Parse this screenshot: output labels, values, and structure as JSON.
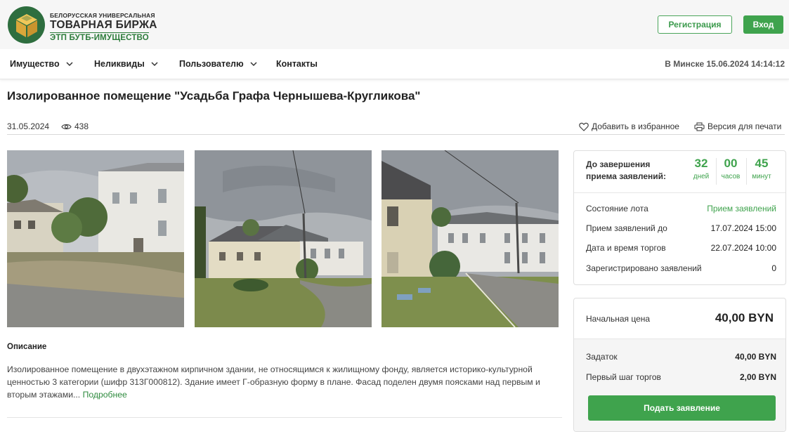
{
  "logo": {
    "line1": "БЕЛОРУССКАЯ УНИВЕРСАЛЬНАЯ",
    "line2": "ТОВАРНАЯ БИРЖА",
    "line3": "ЭТП БУТБ-ИМУЩЕСТВО"
  },
  "header": {
    "register_label": "Регистрация",
    "login_label": "Вход"
  },
  "nav": {
    "items": [
      {
        "label": "Имущество",
        "has_dropdown": true
      },
      {
        "label": "Неликвиды",
        "has_dropdown": true
      },
      {
        "label": "Пользователю",
        "has_dropdown": true
      },
      {
        "label": "Контакты",
        "has_dropdown": false
      }
    ],
    "time": "В Минске 15.06.2024 14:14:12"
  },
  "lot": {
    "title": "Изолированное помещение \"Усадьба Графа Чернышева-Кругликова\"",
    "date": "31.05.2024",
    "views": "438",
    "favorite_label": "Добавить в избранное",
    "print_label": "Версия для печати"
  },
  "photos": [
    {
      "icon": "building-photo"
    },
    {
      "icon": "building-photo"
    },
    {
      "icon": "building-photo"
    }
  ],
  "description": {
    "title": "Описание",
    "text": "Изолированное помещение в двухэтажном кирпичном здании, не относящимся к жилищному фонду, является историко-культурной ценностью 3 категории (шифр 313Г000812). Здание имеет Г-образную форму в плане. Фасад поделен двумя поясками над первым и вторым этажами...",
    "more_label": "Подробнее"
  },
  "countdown": {
    "label": "До завершения приема заявлений:",
    "days": "32",
    "days_unit": "дней",
    "hours": "00",
    "hours_unit": "часов",
    "minutes": "45",
    "minutes_unit": "минут"
  },
  "info": {
    "status_label": "Состояние лота",
    "status_value": "Прием заявлений",
    "accept_until_label": "Прием заявлений до",
    "accept_until_value": "17.07.2024 15:00",
    "auction_label": "Дата и время торгов",
    "auction_value": "22.07.2024 10:00",
    "registered_label": "Зарегистрировано заявлений",
    "registered_value": "0"
  },
  "price": {
    "start_label": "Начальная цена",
    "start_value": "40,00 BYN",
    "deposit_label": "Задаток",
    "deposit_value": "40,00 BYN",
    "step_label": "Первый шаг торгов",
    "step_value": "2,00 BYN",
    "apply_label": "Подать заявление"
  },
  "colors": {
    "accent": "#3fa34d",
    "logo_green": "#2e6e3f",
    "logo_gold": "#e2b84a"
  }
}
